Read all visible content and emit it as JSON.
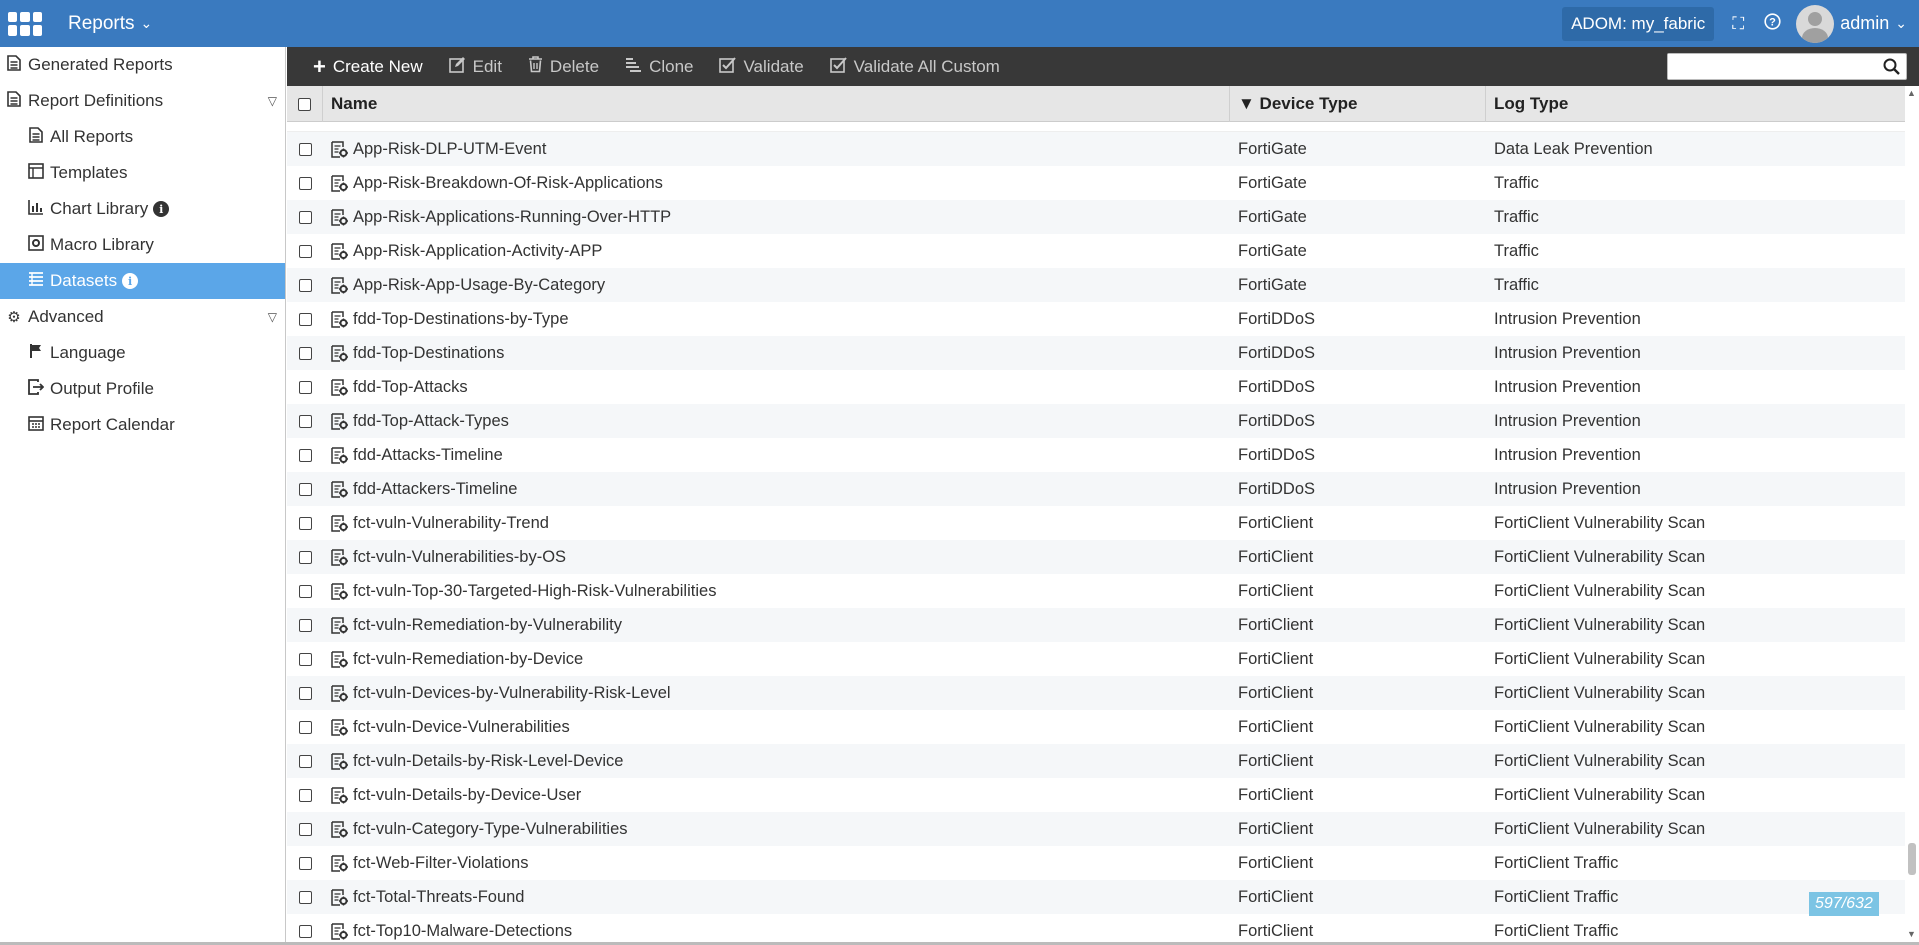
{
  "header": {
    "app_title": "Reports",
    "adom_label": "ADOM: my_fabric",
    "user_name": "admin"
  },
  "sidebar": {
    "generated_reports": "Generated Reports",
    "report_definitions": "Report Definitions",
    "all_reports": "All Reports",
    "templates": "Templates",
    "chart_library": "Chart Library",
    "macro_library": "Macro Library",
    "datasets": "Datasets",
    "advanced": "Advanced",
    "language": "Language",
    "output_profile": "Output Profile",
    "report_calendar": "Report Calendar",
    "active_item": "Datasets"
  },
  "toolbar": {
    "create_new": "Create New",
    "edit": "Edit",
    "delete": "Delete",
    "clone": "Clone",
    "validate": "Validate",
    "validate_all_custom": "Validate All Custom",
    "search_value": ""
  },
  "table": {
    "headers": {
      "name": "Name",
      "device_type": "▼ Device Type",
      "log_type": "Log Type"
    },
    "rows": [
      {
        "name": "App-Risk-DLP-UTM-Event",
        "device": "FortiGate",
        "log": "Data Leak Prevention"
      },
      {
        "name": "App-Risk-Breakdown-Of-Risk-Applications",
        "device": "FortiGate",
        "log": "Traffic"
      },
      {
        "name": "App-Risk-Applications-Running-Over-HTTP",
        "device": "FortiGate",
        "log": "Traffic"
      },
      {
        "name": "App-Risk-Application-Activity-APP",
        "device": "FortiGate",
        "log": "Traffic"
      },
      {
        "name": "App-Risk-App-Usage-By-Category",
        "device": "FortiGate",
        "log": "Traffic"
      },
      {
        "name": "fdd-Top-Destinations-by-Type",
        "device": "FortiDDoS",
        "log": "Intrusion Prevention"
      },
      {
        "name": "fdd-Top-Destinations",
        "device": "FortiDDoS",
        "log": "Intrusion Prevention"
      },
      {
        "name": "fdd-Top-Attacks",
        "device": "FortiDDoS",
        "log": "Intrusion Prevention"
      },
      {
        "name": "fdd-Top-Attack-Types",
        "device": "FortiDDoS",
        "log": "Intrusion Prevention"
      },
      {
        "name": "fdd-Attacks-Timeline",
        "device": "FortiDDoS",
        "log": "Intrusion Prevention"
      },
      {
        "name": "fdd-Attackers-Timeline",
        "device": "FortiDDoS",
        "log": "Intrusion Prevention"
      },
      {
        "name": "fct-vuln-Vulnerability-Trend",
        "device": "FortiClient",
        "log": "FortiClient Vulnerability Scan"
      },
      {
        "name": "fct-vuln-Vulnerabilities-by-OS",
        "device": "FortiClient",
        "log": "FortiClient Vulnerability Scan"
      },
      {
        "name": "fct-vuln-Top-30-Targeted-High-Risk-Vulnerabilities",
        "device": "FortiClient",
        "log": "FortiClient Vulnerability Scan"
      },
      {
        "name": "fct-vuln-Remediation-by-Vulnerability",
        "device": "FortiClient",
        "log": "FortiClient Vulnerability Scan"
      },
      {
        "name": "fct-vuln-Remediation-by-Device",
        "device": "FortiClient",
        "log": "FortiClient Vulnerability Scan"
      },
      {
        "name": "fct-vuln-Devices-by-Vulnerability-Risk-Level",
        "device": "FortiClient",
        "log": "FortiClient Vulnerability Scan"
      },
      {
        "name": "fct-vuln-Device-Vulnerabilities",
        "device": "FortiClient",
        "log": "FortiClient Vulnerability Scan"
      },
      {
        "name": "fct-vuln-Details-by-Risk-Level-Device",
        "device": "FortiClient",
        "log": "FortiClient Vulnerability Scan"
      },
      {
        "name": "fct-vuln-Details-by-Device-User",
        "device": "FortiClient",
        "log": "FortiClient Vulnerability Scan"
      },
      {
        "name": "fct-vuln-Category-Type-Vulnerabilities",
        "device": "FortiClient",
        "log": "FortiClient Vulnerability Scan"
      },
      {
        "name": "fct-Web-Filter-Violations",
        "device": "FortiClient",
        "log": "FortiClient Traffic"
      },
      {
        "name": "fct-Total-Threats-Found",
        "device": "FortiClient",
        "log": "FortiClient Traffic"
      },
      {
        "name": "fct-Top10-Malware-Detections",
        "device": "FortiClient",
        "log": "FortiClient Traffic"
      }
    ]
  },
  "pagination": {
    "counter": "597/632"
  },
  "colors": {
    "header_bg": "#3a7abf",
    "toolbar_bg": "#383838",
    "active_nav": "#5ba6e8",
    "counter_bg": "#7cc4e4"
  }
}
